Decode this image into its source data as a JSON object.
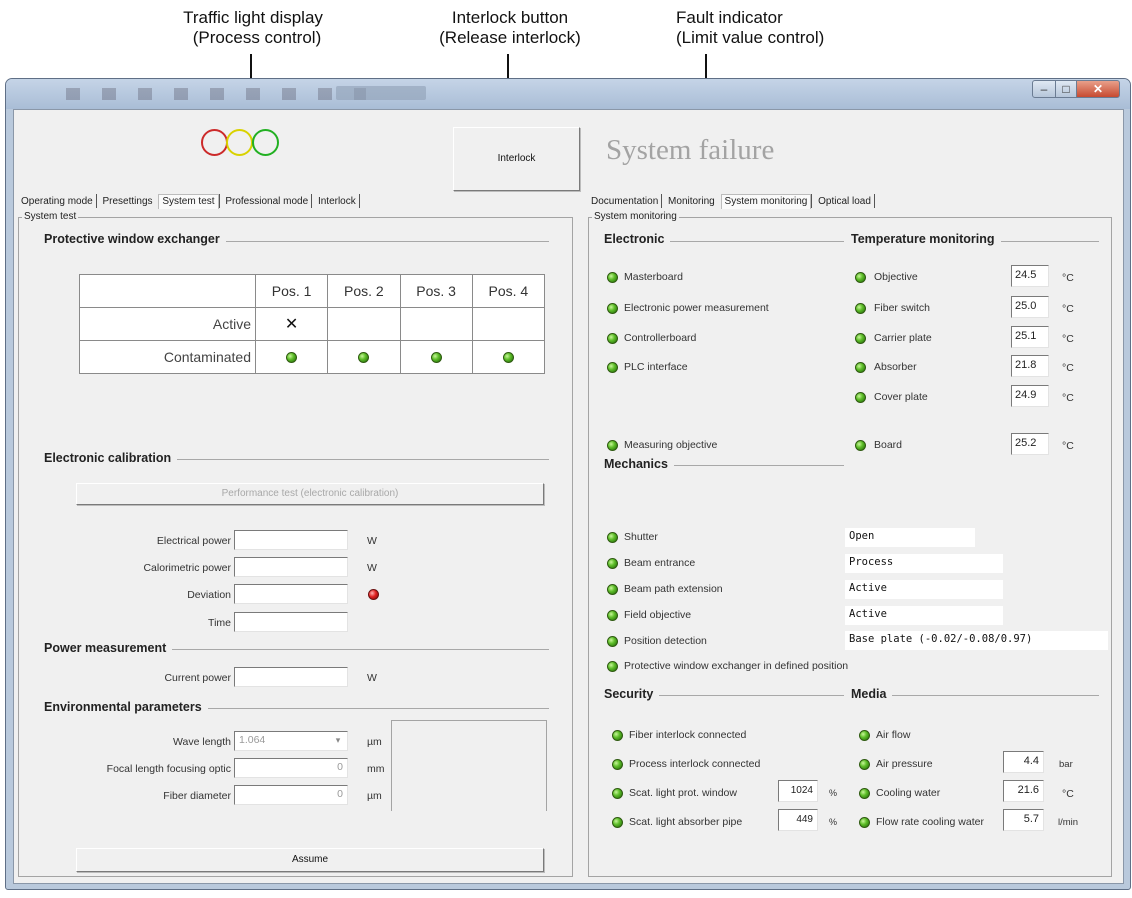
{
  "callouts": {
    "traffic_light": [
      "Traffic light display",
      "(Process control)"
    ],
    "interlock_button": [
      "Interlock button",
      "(Release interlock)"
    ],
    "fault_indicator": [
      "Fault indicator",
      "(Limit value control)"
    ]
  },
  "header": {
    "interlock_button": "Interlock",
    "status_message": "System failure",
    "traffic_lights": [
      {
        "name": "red-light",
        "color": "#cc2a2a"
      },
      {
        "name": "yellow-light",
        "color": "#d9d200"
      },
      {
        "name": "green-light",
        "color": "#22b022"
      }
    ]
  },
  "left": {
    "tabs": [
      "Operating mode",
      "Presettings",
      "System test",
      "Professional mode",
      "Interlock"
    ],
    "active_tab": "System test",
    "panel_label": "System test",
    "pwe": {
      "title": "Protective window exchanger",
      "columns": [
        "Pos. 1",
        "Pos. 2",
        "Pos. 3",
        "Pos. 4"
      ],
      "rows": [
        {
          "label": "Active",
          "cells": [
            "✕",
            "",
            "",
            ""
          ]
        },
        {
          "label": "Contaminated",
          "cells": [
            "led-green",
            "led-green",
            "led-green",
            "led-green"
          ]
        }
      ]
    },
    "calibration": {
      "title": "Electronic calibration",
      "button": "Performance test (electronic calibration)",
      "fields": [
        {
          "label": "Electrical power",
          "unit": "W",
          "value": ""
        },
        {
          "label": "Calorimetric power",
          "unit": "W",
          "value": ""
        },
        {
          "label": "Deviation",
          "unit": "",
          "value": "",
          "led": "red"
        },
        {
          "label": "Time",
          "unit": "",
          "value": ""
        }
      ]
    },
    "power": {
      "title": "Power measurement",
      "fields": [
        {
          "label": "Current power",
          "unit": "W",
          "value": ""
        }
      ]
    },
    "environment": {
      "title": "Environmental parameters",
      "fields": [
        {
          "label": "Wave length",
          "value": "1.064",
          "unit": "µm"
        },
        {
          "label": "Focal length focusing optic",
          "value": "0",
          "unit": "mm"
        },
        {
          "label": "Fiber diameter",
          "value": "0",
          "unit": "µm"
        }
      ],
      "button": "Assume"
    }
  },
  "right": {
    "tabs": [
      "Documentation",
      "Monitoring",
      "System monitoring",
      "Optical load"
    ],
    "active_tab": "System monitoring",
    "panel_label": "System monitoring",
    "electronic": {
      "title": "Electronic",
      "items": [
        "Masterboard",
        "Electronic power measurement",
        "Controllerboard",
        "PLC interface",
        "Measuring objective"
      ]
    },
    "temperature": {
      "title": "Temperature monitoring",
      "unit": "°C",
      "items": [
        {
          "label": "Objective",
          "value": "24.5"
        },
        {
          "label": "Fiber switch",
          "value": "25.0"
        },
        {
          "label": "Carrier plate",
          "value": "25.1"
        },
        {
          "label": "Absorber",
          "value": "21.8"
        },
        {
          "label": "Cover plate",
          "value": "24.9"
        },
        {
          "label": "Board",
          "value": "25.2"
        }
      ]
    },
    "mechanics": {
      "title": "Mechanics",
      "items": [
        {
          "label": "Shutter",
          "value": "Open"
        },
        {
          "label": "Beam entrance",
          "value": "Process"
        },
        {
          "label": "Beam path extension",
          "value": "Active"
        },
        {
          "label": "Field objective",
          "value": "Active"
        },
        {
          "label": "Position detection",
          "value": "Base plate (-0.02/-0.08/0.97)"
        },
        {
          "label": "Protective window exchanger in defined position",
          "value": ""
        }
      ]
    },
    "security": {
      "title": "Security",
      "items": [
        {
          "label": "Fiber interlock connected",
          "value": "",
          "unit": ""
        },
        {
          "label": "Process interlock connected",
          "value": "",
          "unit": ""
        },
        {
          "label": "Scat. light prot. window",
          "value": "1024",
          "unit": "%"
        },
        {
          "label": "Scat. light absorber pipe",
          "value": "449",
          "unit": "%"
        }
      ]
    },
    "media": {
      "title": "Media",
      "items": [
        {
          "label": "Air flow",
          "value": "",
          "unit": ""
        },
        {
          "label": "Air pressure",
          "value": "4.4",
          "unit": "bar"
        },
        {
          "label": "Cooling water",
          "value": "21.6",
          "unit": "°C"
        },
        {
          "label": "Flow rate cooling water",
          "value": "5.7",
          "unit": "l/min"
        }
      ]
    }
  }
}
